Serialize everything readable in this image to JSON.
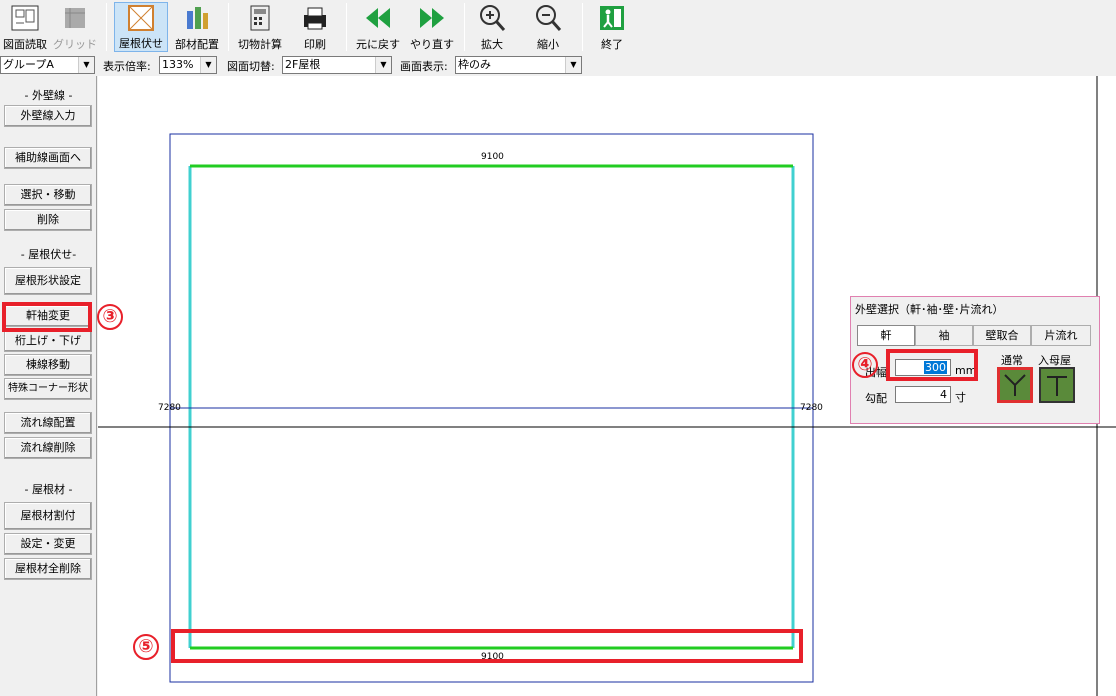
{
  "toolbar": {
    "buttons": [
      {
        "label": "図面読取",
        "icon": "drawing-read-icon"
      },
      {
        "label": "グリッド",
        "icon": "grid-icon"
      },
      {
        "label": "屋根伏せ",
        "icon": "roof-plan-icon"
      },
      {
        "label": "部材配置",
        "icon": "parts-placement-icon"
      },
      {
        "label": "切物計算",
        "icon": "cut-calc-icon"
      },
      {
        "label": "印刷",
        "icon": "print-icon"
      },
      {
        "label": "元に戻す",
        "icon": "undo-icon"
      },
      {
        "label": "やり直す",
        "icon": "redo-icon"
      },
      {
        "label": "拡大",
        "icon": "zoom-in-icon"
      },
      {
        "label": "縮小",
        "icon": "zoom-out-icon"
      },
      {
        "label": "終了",
        "icon": "exit-icon"
      }
    ]
  },
  "combos": {
    "group": "グループA",
    "zoom_label": "表示倍率:",
    "zoom_value": "133%",
    "drawing_label": "図面切替:",
    "drawing_value": "2F屋根",
    "display_label": "画面表示:",
    "display_value": "枠のみ"
  },
  "left_panel": {
    "sec_wall": "- 外壁線 -",
    "wall_input": "外壁線入力",
    "aux_screen": "補助線画面へ",
    "select_move": "選択・移動",
    "delete": "削除",
    "sec_roof": "- 屋根伏せ-",
    "roof_shape": "屋根形状設定",
    "eave_change": "軒袖変更",
    "beam_updown": "桁上げ・下げ",
    "ridge_move": "棟線移動",
    "special_corner": "特殊コーナー形状",
    "flow_place": "流れ線配置",
    "flow_delete": "流れ線削除",
    "sec_material": "- 屋根材 -",
    "material_assign": "屋根材割付",
    "setting_change": "設定・変更",
    "material_delete_all": "屋根材全削除"
  },
  "canvas": {
    "dim_top": "9100",
    "dim_bottom": "9100",
    "dim_left": "7280",
    "dim_right": "7280"
  },
  "dialog": {
    "title": "外壁選択（軒･袖･壁･片流れ）",
    "tabs": [
      "軒",
      "袖",
      "壁取合",
      "片流れ"
    ],
    "overhang_label": "出幅",
    "overhang_value": "300",
    "overhang_unit": "mm",
    "pitch_label": "勾配",
    "pitch_value": "4",
    "pitch_unit": "寸",
    "normal_label": "通常",
    "hip_gable_label": "入母屋"
  },
  "annotations": {
    "step3": "③",
    "step4": "④",
    "step5": "⑤"
  },
  "colors": {
    "annotation_red": "#e8202a",
    "outline_blue": "#1a2fa0",
    "roof_green": "#22cc22",
    "roof_cyan": "#40d0d0"
  }
}
